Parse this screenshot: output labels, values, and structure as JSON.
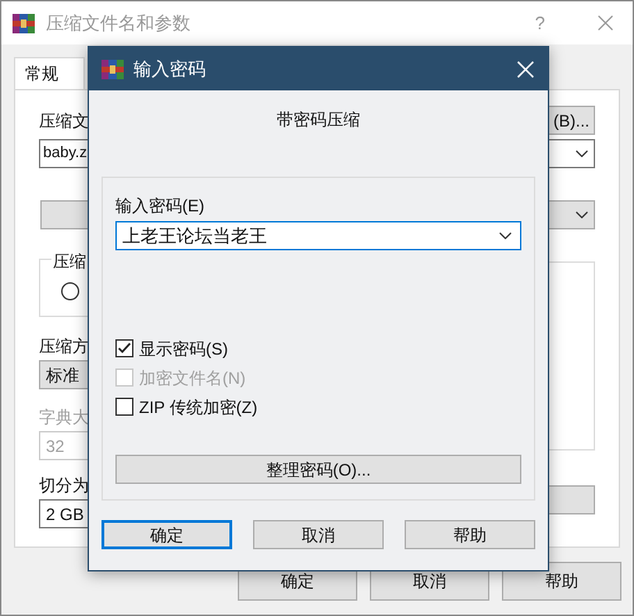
{
  "window": {
    "title": "压缩文件名和参数",
    "help_button": "?"
  },
  "tabs": [
    {
      "label": "常规",
      "selected": true
    }
  ],
  "general_panel": {
    "archive_name_label": "压缩文",
    "browse_button": "(B)...",
    "archive_name_value": "baby.z",
    "format_group_label": "压缩",
    "format_radio": {
      "selected": false
    },
    "method_label": "压缩方",
    "method_value": "标准",
    "dictionary_label": "字典大",
    "dictionary_value": "32",
    "split_label": "切分为",
    "split_value": "2 GB"
  },
  "buttons": [
    {
      "label": "确定"
    },
    {
      "label": "取消"
    },
    {
      "label": "帮助"
    }
  ],
  "password_dialog": {
    "title": "输入密码",
    "heading": "带密码压缩",
    "password_label": "输入密码(E)",
    "password_value": "上老王论坛当老王",
    "checkboxes": [
      {
        "label": "显示密码(S)",
        "checked": true,
        "disabled": false
      },
      {
        "label": "加密文件名(N)",
        "checked": false,
        "disabled": true
      },
      {
        "label": "ZIP 传统加密(Z)",
        "checked": false,
        "disabled": false
      }
    ],
    "organize_button": "整理密码(O)...",
    "buttons": [
      {
        "label": "确定",
        "focused": true
      },
      {
        "label": "取消",
        "focused": false
      },
      {
        "label": "帮助",
        "focused": false
      }
    ]
  }
}
